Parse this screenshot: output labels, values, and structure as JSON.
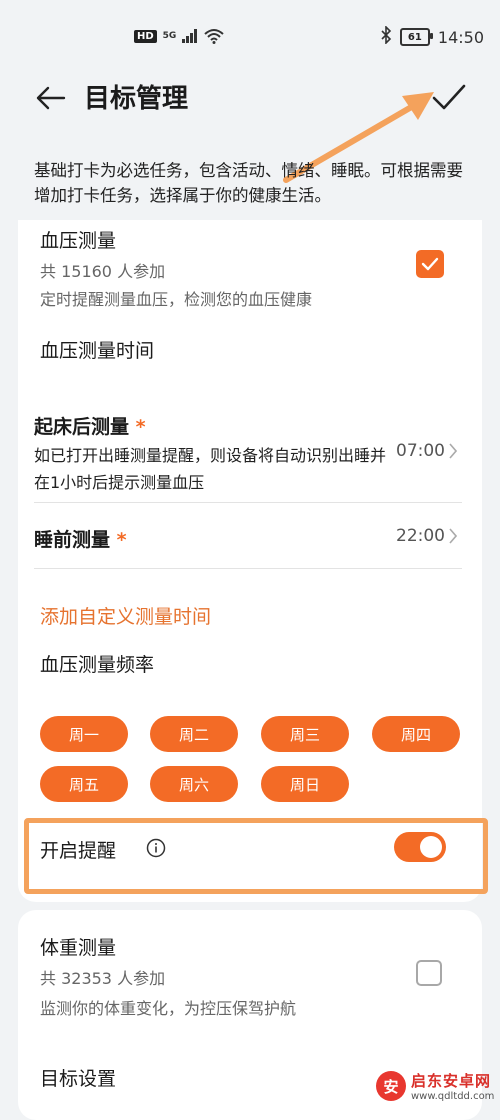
{
  "status_bar": {
    "hd": "HD",
    "network": "5G",
    "battery": "61",
    "time": "14:50"
  },
  "header": {
    "title": "目标管理"
  },
  "description": "基础打卡为必选任务，包含活动、情绪、睡眠。可根据需要增加打卡任务，选择属于你的健康生活。",
  "blood_pressure": {
    "title": "血压测量",
    "participants": "共 15160 人参加",
    "subtitle": "定时提醒测量血压，检测您的血压健康",
    "checked": true,
    "time_heading": "血压测量时间",
    "wake": {
      "label": "起床后测量",
      "required_mark": "*",
      "desc": "如已打开出睡测量提醒，则设备将自动识别出睡并在1小时后提示测量血压",
      "value": "07:00"
    },
    "sleep": {
      "label": "睡前测量",
      "required_mark": "*",
      "value": "22:00"
    },
    "add_custom": "添加自定义测量时间",
    "frequency_heading": "血压测量频率",
    "days": [
      "周一",
      "周二",
      "周三",
      "周四",
      "周五",
      "周六",
      "周日"
    ],
    "reminder": {
      "label": "开启提醒",
      "on": true
    }
  },
  "weight": {
    "title": "体重测量",
    "participants": "共 32353 人参加",
    "subtitle": "监测你的体重变化，为控压保驾护航",
    "checked": false,
    "goal_label": "目标设置"
  },
  "watermark": {
    "name": "启东安卓网",
    "url": "www.qdltdd.com"
  },
  "colors": {
    "accent": "#f36b26",
    "annotation": "#f4a25c",
    "background": "#f1f3f5"
  },
  "icons": [
    "back-arrow-icon",
    "confirm-check-icon",
    "info-icon",
    "bluetooth-icon",
    "wifi-icon",
    "chevron-right-icon"
  ]
}
